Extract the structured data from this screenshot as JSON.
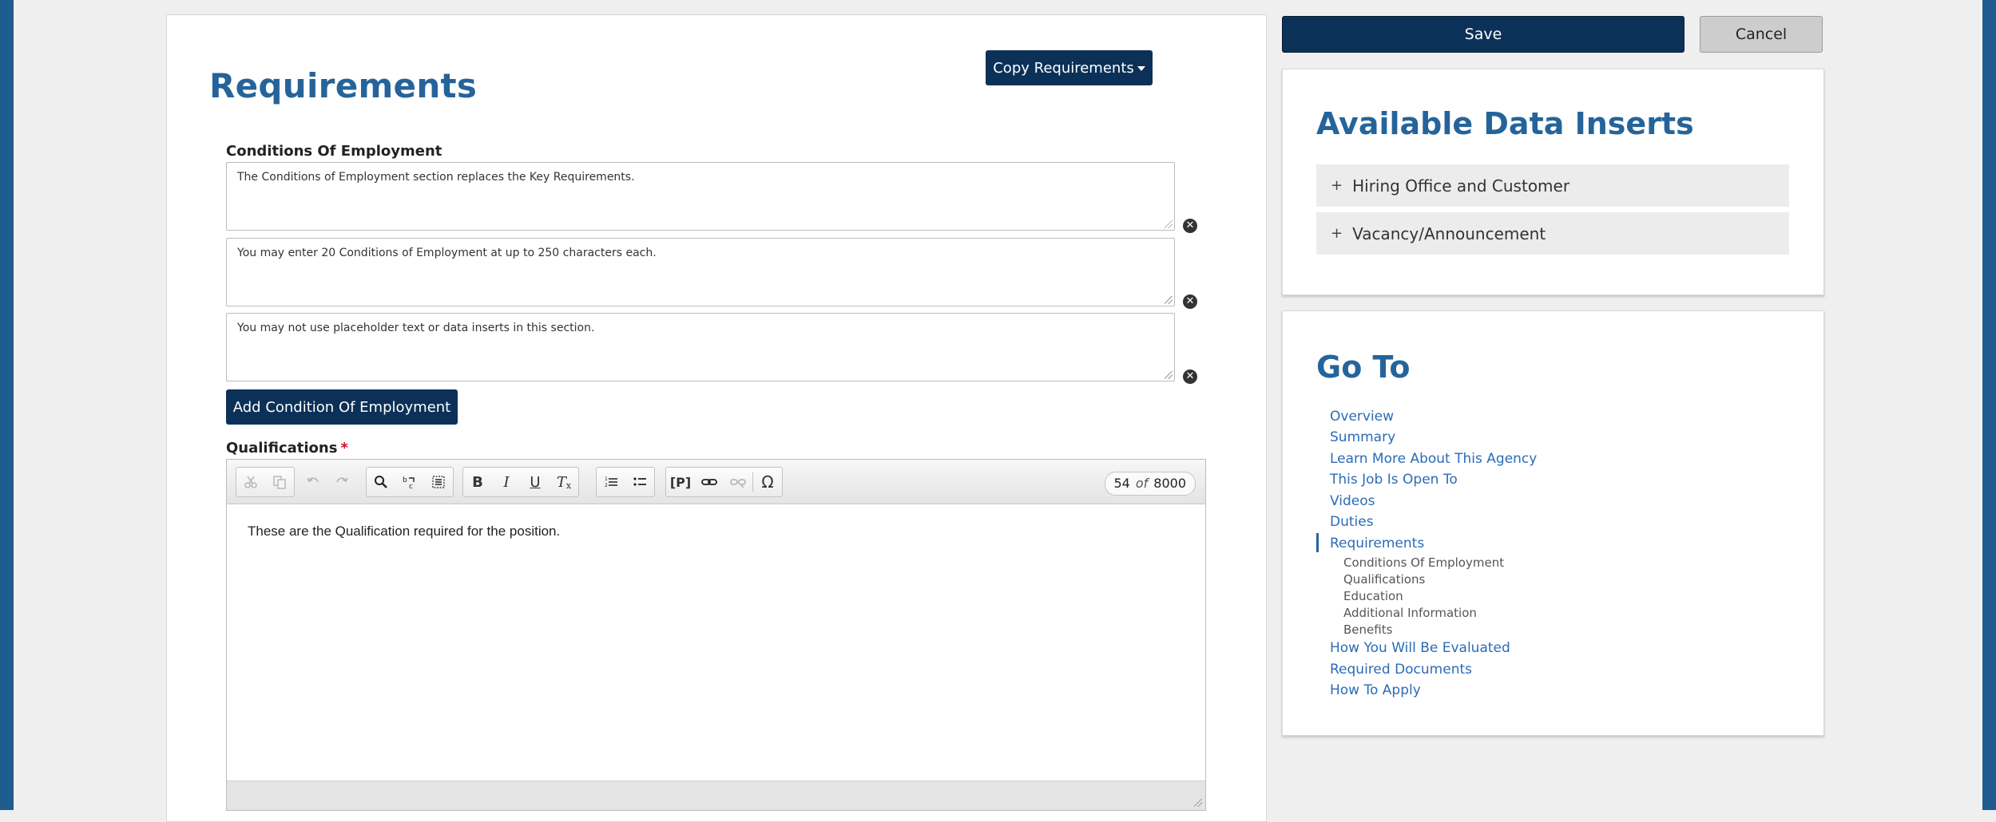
{
  "requirements": {
    "title": "Requirements",
    "copy_button": "Copy Requirements",
    "conditions": {
      "label": "Conditions Of Employment",
      "items": [
        "The Conditions of  Employment section replaces the Key Requirements.",
        "You may enter 20 Conditions of Employment at up to 250 characters each.",
        "You may not use placeholder text or data inserts in this section."
      ],
      "add_button": "Add Condition Of Employment"
    },
    "qualifications": {
      "label": "Qualifications",
      "required_marker": "*",
      "editor_text": "These are the Qualification required for the position.",
      "char_count": {
        "current": "54",
        "of": "of",
        "max": "8000"
      },
      "toolbar_icons": [
        "cut-icon",
        "copy-icon",
        "undo-icon",
        "redo-icon",
        "find-icon",
        "replace-icon",
        "select-all-icon",
        "bold-icon",
        "italic-icon",
        "underline-icon",
        "remove-format-icon",
        "numbered-list-icon",
        "bulleted-list-icon",
        "placeholder-icon",
        "link-icon",
        "unlink-icon",
        "special-char-icon"
      ]
    }
  },
  "actions": {
    "save": "Save",
    "cancel": "Cancel"
  },
  "data_inserts": {
    "title": "Available Data Inserts",
    "items": [
      "Hiring Office and Customer",
      "Vacancy/Announcement"
    ],
    "expand_glyph": "+"
  },
  "goto": {
    "title": "Go To",
    "links": [
      "Overview",
      "Summary",
      "Learn More About This Agency",
      "This Job Is Open To",
      "Videos",
      "Duties",
      "Requirements"
    ],
    "active": "Requirements",
    "sub_links": [
      "Conditions Of Employment",
      "Qualifications",
      "Education",
      "Additional Information",
      "Benefits"
    ],
    "after_links": [
      "How You Will Be Evaluated",
      "Required Documents",
      "How To Apply"
    ]
  },
  "colors": {
    "accent": "#25649a",
    "button_dark": "#0b3158",
    "link": "#2b6cb6",
    "edge": "#1e5b8e"
  }
}
